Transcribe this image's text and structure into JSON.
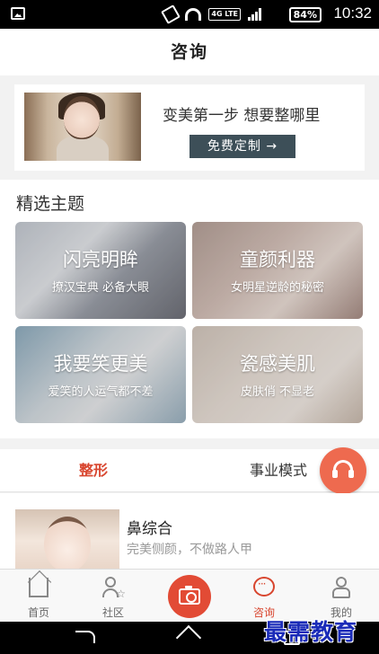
{
  "status_bar": {
    "lte": "4G LTE",
    "battery": "84%",
    "time": "10:32"
  },
  "header": {
    "title": "咨询"
  },
  "banner": {
    "title": "变美第一步 想要整哪里",
    "button_label": "免费定制 →"
  },
  "featured": {
    "section_title": "精选主题",
    "tiles": [
      {
        "title": "闪亮明眸",
        "subtitle": "撩汉宝典 必备大眼"
      },
      {
        "title": "童颜利器",
        "subtitle": "女明星逆龄的秘密"
      },
      {
        "title": "我要笑更美",
        "subtitle": "爱笑的人运气都不差"
      },
      {
        "title": "瓷感美肌",
        "subtitle": "皮肤俏 不显老"
      }
    ]
  },
  "tabs": [
    {
      "label": "整形",
      "active": true
    },
    {
      "label": "事业模式",
      "active": false
    }
  ],
  "list": {
    "items": [
      {
        "title": "鼻综合",
        "subtitle": "完美侧颜，不做路人甲"
      }
    ]
  },
  "bottom_nav": {
    "items": [
      {
        "label": "首页",
        "icon": "home-icon"
      },
      {
        "label": "社区",
        "icon": "community-icon"
      },
      {
        "label": "",
        "icon": "camera-icon"
      },
      {
        "label": "咨询",
        "icon": "chat-icon",
        "active": true
      },
      {
        "label": "我的",
        "icon": "profile-icon"
      }
    ]
  },
  "watermark": "最需教育",
  "colors": {
    "accent": "#d8452e",
    "banner_button": "#3d4f58",
    "float_button": "#ee6a4f"
  }
}
